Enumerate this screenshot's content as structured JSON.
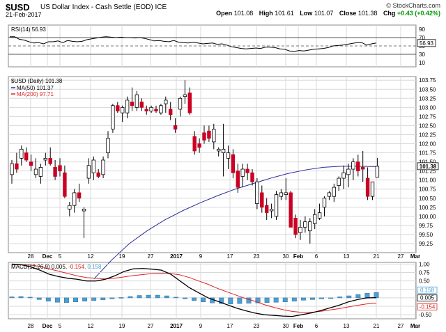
{
  "header": {
    "symbol": "$USD",
    "name": "US Dollar Index - Cash Settle (EOD) ICE",
    "date": "21-Feb-2017",
    "credit": "© StockCharts.com",
    "open_label": "Open",
    "open": "101.08",
    "high_label": "High",
    "high": "101.61",
    "low_label": "Low",
    "low": "101.07",
    "close_label": "Close",
    "close": "101.38",
    "chg_label": "Chg",
    "chg": "+0.43 (+0.42%)"
  },
  "colors": {
    "up": "#ffffff",
    "down": "#cc0022",
    "neutral": "#000000",
    "ma50": "#2a2a9a",
    "ma200": "#dd2222",
    "rsi": "#000000",
    "rsi_fill": "#2f6f2f",
    "macd": "#000000",
    "signal": "#dd2222",
    "hist": "#4a9fd4",
    "grid": "#d8d8d8"
  },
  "chart_data": [
    {
      "type": "line",
      "name": "RSI",
      "legend": "RSI(14) 56.93",
      "ylim": [
        0,
        100
      ],
      "yticks": [
        10,
        30,
        50,
        70,
        90
      ],
      "last_label": "56.93",
      "values": [
        72,
        72,
        66,
        64,
        60,
        57,
        58,
        55,
        60,
        60,
        62,
        58,
        63,
        61,
        60,
        61,
        65,
        67,
        69,
        71,
        72,
        71,
        70,
        71,
        70,
        70,
        69,
        70,
        68,
        65,
        62,
        63,
        61,
        60,
        63,
        59,
        58,
        57,
        59,
        57,
        55,
        56,
        57,
        54,
        55,
        52,
        48,
        46,
        44,
        43,
        44,
        45,
        44,
        47,
        47,
        46,
        43,
        42,
        38,
        37,
        39,
        38,
        40,
        42,
        43,
        44,
        46,
        50,
        51,
        52,
        54,
        56,
        58,
        58,
        52,
        55,
        57
      ]
    },
    {
      "type": "candlestick",
      "name": "$USD (Daily)",
      "legend": [
        "$USD (Daily) 101.38",
        "MA(50) 101.37",
        "MA(200) 97.71"
      ],
      "ylim": [
        99.0,
        103.85
      ],
      "yticks": [
        "99.25",
        "99.50",
        "99.75",
        "100.00",
        "100.25",
        "100.50",
        "100.75",
        "101.00",
        "101.25",
        "101.50",
        "101.75",
        "102.00",
        "102.25",
        "102.50",
        "102.75",
        "103.00",
        "103.25",
        "103.50",
        "103.75"
      ],
      "last_label": "101.38",
      "x_labels": [
        "28",
        "Dec",
        "5",
        "12",
        "19",
        "27",
        "2017",
        "9",
        "17",
        "23",
        "30",
        "Feb",
        "6",
        "13",
        "21",
        "27",
        "Mar"
      ],
      "ohlc": [
        [
          101.15,
          101.55,
          100.9,
          101.45
        ],
        [
          101.45,
          101.75,
          101.2,
          101.3
        ],
        [
          101.6,
          101.95,
          101.4,
          101.85
        ],
        [
          101.75,
          101.9,
          101.5,
          101.55
        ],
        [
          101.5,
          101.7,
          101.25,
          101.4
        ],
        [
          101.15,
          101.6,
          101.05,
          101.3
        ],
        [
          101.1,
          101.45,
          100.9,
          101.35
        ],
        [
          101.55,
          101.75,
          101.4,
          101.6
        ],
        [
          101.6,
          101.9,
          101.4,
          101.45
        ],
        [
          101.35,
          101.55,
          101.0,
          101.1
        ],
        [
          101.4,
          101.6,
          101.1,
          101.25
        ],
        [
          101.2,
          101.4,
          100.5,
          100.55
        ],
        [
          100.2,
          100.4,
          100.0,
          100.3
        ],
        [
          100.3,
          100.75,
          100.1,
          100.65
        ],
        [
          100.65,
          100.9,
          100.4,
          100.5
        ],
        [
          100.15,
          100.25,
          99.4,
          100.2
        ],
        [
          101.05,
          101.6,
          100.9,
          101.4
        ],
        [
          101.2,
          101.65,
          101.0,
          101.55
        ],
        [
          101.2,
          101.3,
          101.05,
          101.1
        ],
        [
          101.15,
          101.65,
          101.05,
          101.55
        ],
        [
          101.75,
          102.35,
          101.6,
          102.15
        ],
        [
          102.4,
          103.1,
          102.3,
          103.05
        ],
        [
          103.05,
          103.15,
          102.85,
          102.9
        ],
        [
          102.85,
          103.05,
          102.6,
          103.0
        ],
        [
          102.85,
          103.3,
          102.7,
          103.2
        ],
        [
          103.15,
          103.55,
          102.9,
          103.05
        ],
        [
          103.0,
          103.45,
          102.9,
          103.35
        ],
        [
          103.15,
          103.25,
          102.9,
          103.0
        ],
        [
          102.95,
          103.05,
          102.8,
          102.9
        ],
        [
          102.9,
          103.05,
          102.85,
          103.0
        ],
        [
          102.95,
          103.05,
          102.85,
          102.9
        ],
        [
          102.85,
          103.1,
          102.8,
          103.05
        ],
        [
          103.1,
          103.3,
          102.85,
          103.2
        ],
        [
          102.95,
          103.15,
          102.65,
          102.8
        ],
        [
          102.5,
          102.7,
          102.3,
          102.4
        ],
        [
          102.95,
          103.3,
          102.75,
          103.25
        ],
        [
          103.3,
          103.75,
          103.1,
          103.35
        ],
        [
          103.4,
          103.55,
          102.8,
          102.85
        ],
        [
          102.2,
          102.35,
          101.7,
          101.8
        ],
        [
          102.0,
          102.15,
          101.75,
          101.9
        ],
        [
          102.3,
          102.5,
          102.0,
          102.1
        ],
        [
          102.35,
          102.5,
          102.05,
          102.15
        ],
        [
          102.05,
          102.55,
          101.85,
          102.4
        ],
        [
          101.8,
          101.9,
          101.65,
          101.85
        ],
        [
          101.75,
          102.55,
          101.1,
          101.85
        ],
        [
          101.6,
          101.95,
          101.3,
          101.75
        ],
        [
          101.7,
          101.85,
          101.05,
          101.2
        ],
        [
          101.25,
          101.45,
          100.65,
          100.8
        ],
        [
          101.1,
          101.45,
          100.8,
          101.3
        ],
        [
          101.3,
          101.45,
          101.0,
          101.2
        ],
        [
          101.2,
          101.3,
          100.85,
          100.95
        ],
        [
          100.35,
          101.05,
          100.2,
          100.95
        ],
        [
          100.65,
          100.85,
          100.1,
          100.25
        ],
        [
          100.3,
          100.5,
          99.9,
          100.1
        ],
        [
          100.15,
          100.35,
          99.95,
          100.2
        ],
        [
          100.0,
          100.7,
          99.9,
          100.6
        ],
        [
          100.55,
          100.75,
          100.45,
          100.65
        ],
        [
          100.6,
          101.05,
          100.45,
          100.65
        ],
        [
          100.65,
          100.7,
          99.75,
          99.7
        ],
        [
          99.95,
          100.05,
          99.4,
          99.5
        ],
        [
          99.55,
          99.9,
          99.35,
          99.7
        ],
        [
          99.7,
          100.0,
          99.55,
          99.85
        ],
        [
          99.6,
          99.95,
          99.25,
          99.85
        ],
        [
          99.8,
          100.2,
          99.65,
          100.05
        ],
        [
          99.95,
          100.35,
          99.9,
          100.1
        ],
        [
          100.25,
          100.55,
          100.0,
          100.5
        ],
        [
          100.55,
          100.7,
          100.45,
          100.65
        ],
        [
          100.55,
          100.9,
          100.4,
          100.8
        ],
        [
          100.85,
          101.1,
          100.7,
          101.05
        ],
        [
          101.05,
          101.4,
          100.75,
          101.2
        ],
        [
          101.15,
          101.45,
          100.8,
          101.3
        ],
        [
          101.3,
          101.6,
          101.0,
          101.5
        ],
        [
          101.5,
          101.7,
          101.1,
          101.25
        ],
        [
          101.35,
          101.8,
          100.95,
          101.3
        ],
        [
          101.05,
          101.35,
          100.45,
          100.55
        ],
        [
          100.55,
          100.95,
          100.45,
          100.95
        ],
        [
          101.08,
          101.61,
          101.07,
          101.38
        ]
      ],
      "ma50": [
        98.28,
        98.8,
        99.25,
        99.6,
        99.9,
        100.15,
        100.37,
        100.57,
        100.75,
        100.9,
        101.05,
        101.18,
        101.28,
        101.35,
        101.38,
        101.38,
        101.37
      ],
      "ma200": [
        97.71
      ]
    },
    {
      "type": "line",
      "name": "MACD",
      "legend": {
        "main": "MACD(12,26,9)",
        "macd": "0.005",
        "signal": "-0.154",
        "hist": "0.158"
      },
      "ylim": [
        -0.62,
        1.05
      ],
      "yticks": [
        "-0.50",
        "-0.25",
        "0.00",
        "0.25",
        "0.50",
        "0.75",
        "1.00"
      ],
      "last_labels": [
        "0.158",
        "0.005",
        "-0.154"
      ],
      "macd": [
        1.0,
        0.98,
        0.92,
        0.82,
        0.7,
        0.63,
        0.58,
        0.55,
        0.5,
        0.5,
        0.55,
        0.65,
        0.78,
        0.86,
        0.87,
        0.85,
        0.82,
        0.7,
        0.5,
        0.3,
        0.15,
        0.0,
        -0.1,
        -0.2,
        -0.3,
        -0.38,
        -0.45,
        -0.5,
        -0.52,
        -0.54,
        -0.55,
        -0.5,
        -0.45,
        -0.38,
        -0.3,
        -0.22,
        -0.12,
        -0.05,
        0.0,
        0.005
      ],
      "signal": [
        0.98,
        0.98,
        0.97,
        0.93,
        0.86,
        0.79,
        0.72,
        0.65,
        0.6,
        0.58,
        0.56,
        0.58,
        0.62,
        0.66,
        0.69,
        0.72,
        0.73,
        0.72,
        0.68,
        0.6,
        0.5,
        0.4,
        0.28,
        0.18,
        0.08,
        -0.02,
        -0.1,
        -0.2,
        -0.28,
        -0.35,
        -0.4,
        -0.43,
        -0.43,
        -0.4,
        -0.36,
        -0.32,
        -0.27,
        -0.22,
        -0.18,
        -0.154
      ],
      "hist": [
        0.03,
        0.04,
        0.02,
        -0.05,
        -0.1,
        -0.13,
        -0.14,
        -0.12,
        -0.1,
        -0.08,
        -0.06,
        -0.03,
        0.01,
        0.04,
        0.07,
        0.08,
        0.08,
        0.06,
        0.02,
        -0.03,
        -0.08,
        -0.12,
        -0.15,
        -0.17,
        -0.18,
        -0.17,
        -0.16,
        -0.15,
        -0.14,
        -0.13,
        -0.12,
        -0.1,
        -0.07,
        -0.05,
        -0.03,
        0.0,
        0.03,
        0.06,
        0.1,
        0.14,
        0.158
      ],
      "x_labels": [
        "28",
        "Dec",
        "5",
        "12",
        "19",
        "27",
        "2017",
        "9",
        "17",
        "23",
        "30",
        "Feb",
        "6",
        "13",
        "21",
        "27",
        "Mar"
      ]
    }
  ]
}
